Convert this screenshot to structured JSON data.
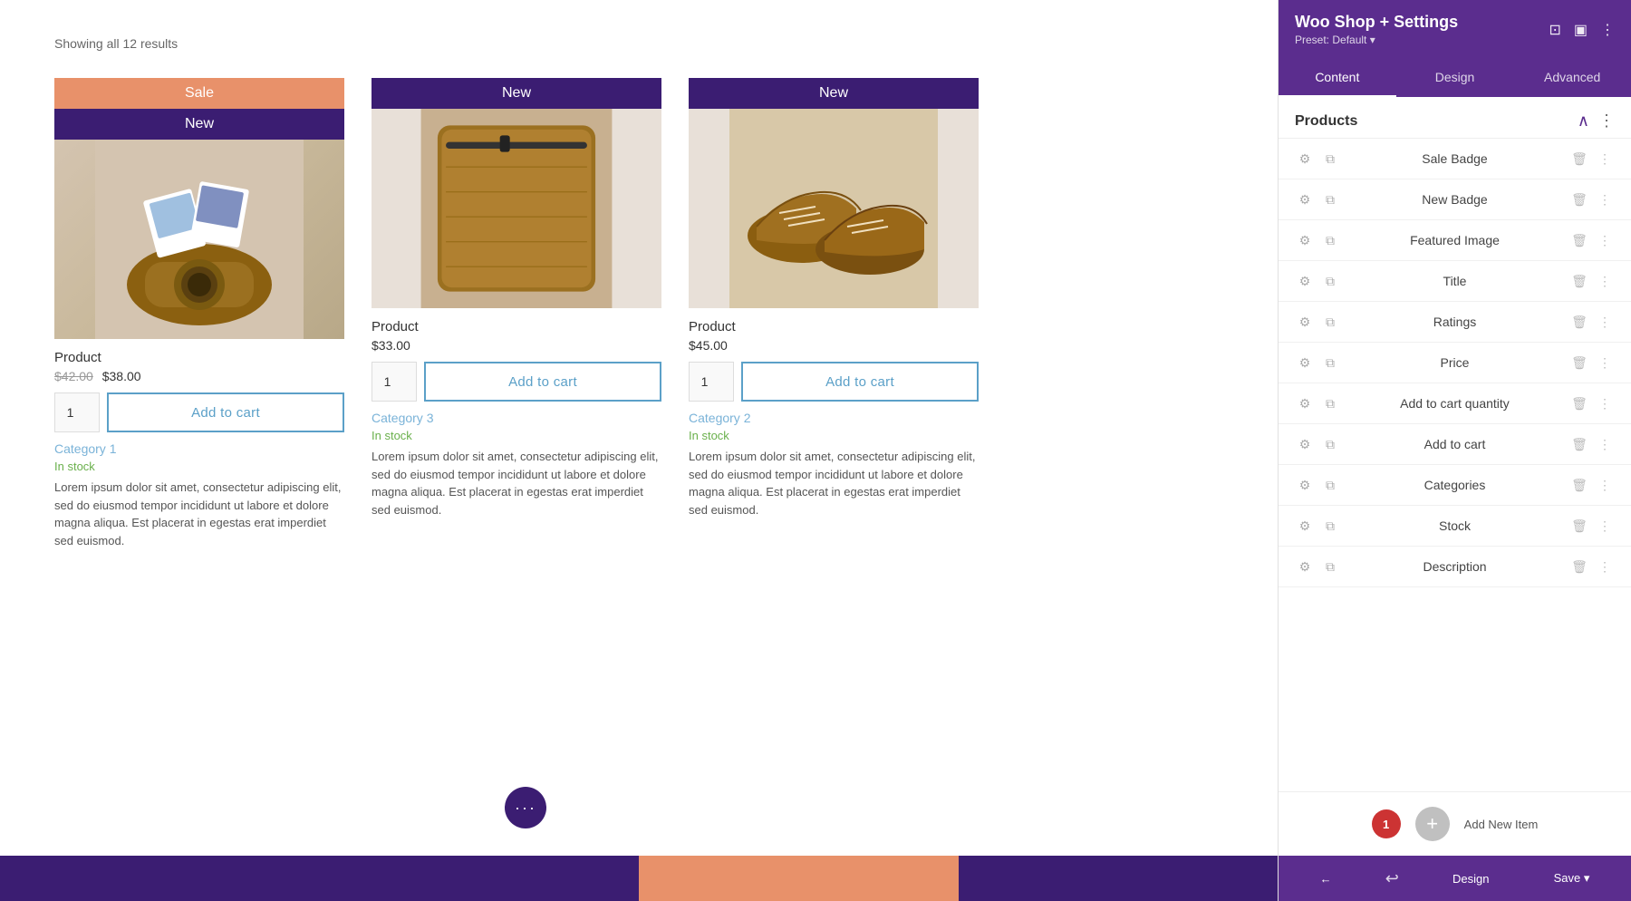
{
  "page": {
    "results_count": "Showing all 12 results"
  },
  "products": [
    {
      "id": 1,
      "badges": [
        "Sale",
        "New"
      ],
      "badge_sale_color": "#e8916a",
      "badge_new_color": "#3b1d72",
      "title": "Product",
      "price_original": "$42.00",
      "price_sale": "$38.00",
      "has_sale": true,
      "qty": "1",
      "add_to_cart_label": "Add to cart",
      "category": "Category 1",
      "stock": "In stock",
      "description": "Lorem ipsum dolor sit amet, consectetur adipiscing elit, sed do eiusmod tempor incididunt ut labore et dolore magna aliqua. Est placerat in egestas erat imperdiet sed euismod."
    },
    {
      "id": 2,
      "badges": [
        "New"
      ],
      "badge_new_color": "#3b1d72",
      "title": "Product",
      "price_regular": "$33.00",
      "has_sale": false,
      "qty": "1",
      "add_to_cart_label": "Add to cart",
      "category": "Category 3",
      "stock": "In stock",
      "description": "Lorem ipsum dolor sit amet, consectetur adipiscing elit, sed do eiusmod tempor incididunt ut labore et dolore magna aliqua. Est placerat in egestas erat imperdiet sed euismod."
    },
    {
      "id": 3,
      "badges": [
        "New"
      ],
      "badge_new_color": "#3b1d72",
      "title": "Product",
      "price_regular": "$45.00",
      "has_sale": false,
      "qty": "1",
      "add_to_cart_label": "Add to cart",
      "category": "Category 2",
      "stock": "In stock",
      "description": "Lorem ipsum dolor sit amet, consectetur adipiscing elit, sed do eiusmod tempor incididunt ut labore et dolore magna aliqua. Est placerat in egestas erat imperdiet sed euismod."
    }
  ],
  "panel": {
    "title": "Woo Shop + Settings",
    "preset_label": "Preset: Default",
    "tabs": [
      "Content",
      "Design",
      "Advanced"
    ],
    "active_tab": "Content",
    "section_title": "Products",
    "items": [
      {
        "label": "Sale Badge"
      },
      {
        "label": "New Badge"
      },
      {
        "label": "Featured Image"
      },
      {
        "label": "Title"
      },
      {
        "label": "Ratings"
      },
      {
        "label": "Price"
      },
      {
        "label": "Add to cart quantity"
      },
      {
        "label": "Add to cart"
      },
      {
        "label": "Categories"
      },
      {
        "label": "Stock"
      },
      {
        "label": "Description"
      }
    ],
    "add_new_label": "Add New Item",
    "badge_count": "1",
    "footer_buttons": [
      "← undo",
      "Design",
      "Save ▼"
    ]
  },
  "floating": {
    "dots": "···"
  }
}
